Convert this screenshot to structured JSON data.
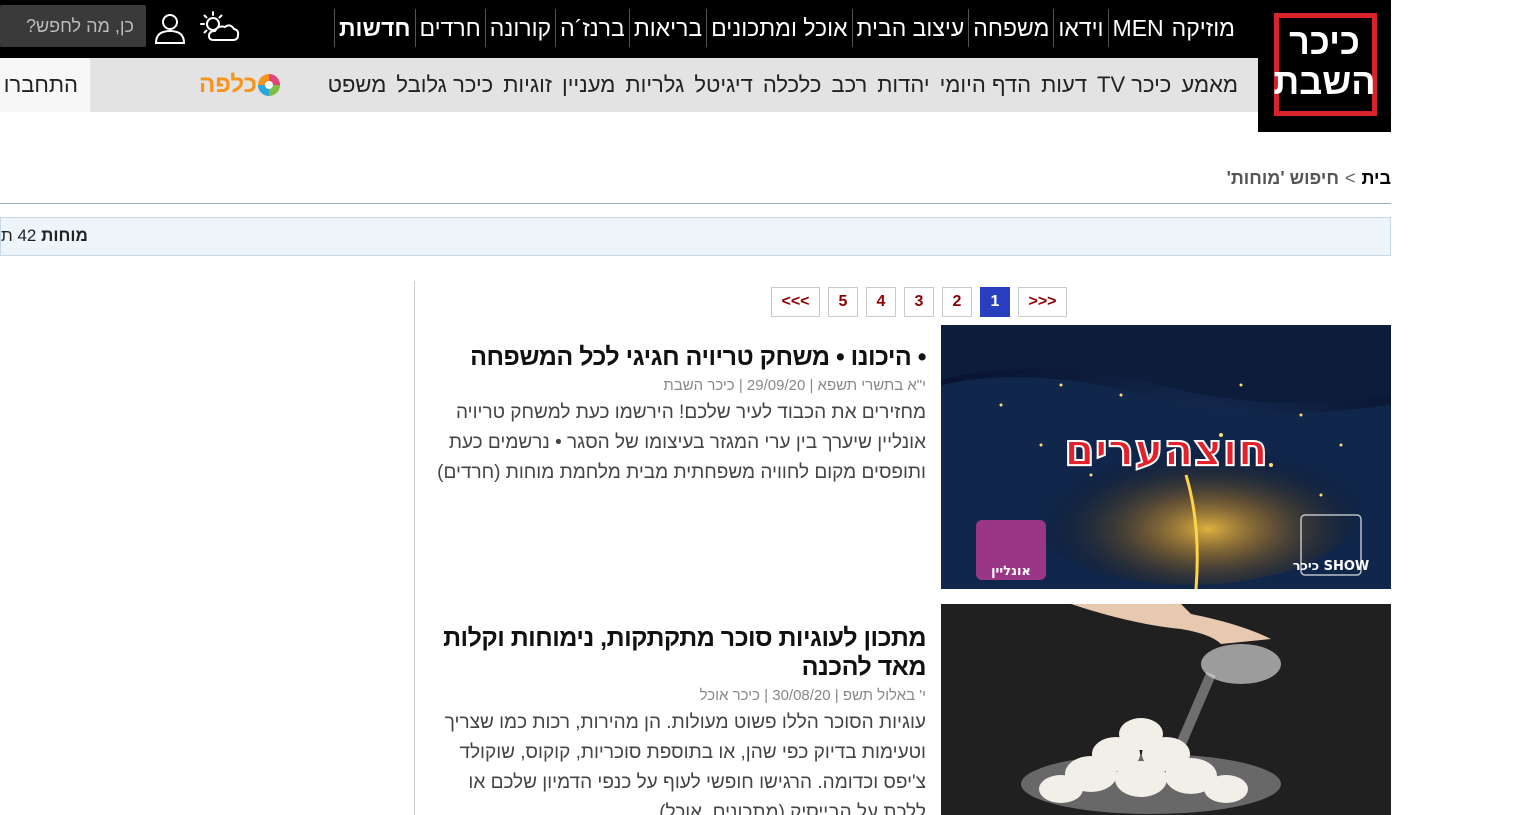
{
  "logo": {
    "line1": "כיכר",
    "line2": "השבת"
  },
  "main_nav": [
    {
      "label": "חדשות",
      "bold": true
    },
    {
      "label": "חרדים"
    },
    {
      "label": "קורונה"
    },
    {
      "label": "ברנז´ה"
    },
    {
      "label": "בריאות"
    },
    {
      "label": "אוכל ומתכונים"
    },
    {
      "label": "עיצוב הבית"
    },
    {
      "label": "משפחה"
    },
    {
      "label": "וידאו"
    },
    {
      "label": "MEN"
    },
    {
      "label": "מוזיקה"
    }
  ],
  "search": {
    "placeholder": "כן, מה לחפש?"
  },
  "icons": {
    "weather": "weather-partly-cloudy-icon",
    "user": "user-icon"
  },
  "sub_nav": [
    {
      "label": "משפט"
    },
    {
      "label": "כיכר גלובל"
    },
    {
      "label": "זוגיות"
    },
    {
      "label": "מעניין"
    },
    {
      "label": "גלריות"
    },
    {
      "label": "דיגיטל"
    },
    {
      "label": "כלכלה"
    },
    {
      "label": "רכב"
    },
    {
      "label": "יהדות"
    },
    {
      "label": "הדף היומי"
    },
    {
      "label": "דעות"
    },
    {
      "label": "כיכר TV"
    },
    {
      "label": "מאמע"
    }
  ],
  "kalpa": {
    "label": "כלפה"
  },
  "login": {
    "label": "התחברו"
  },
  "breadcrumb": {
    "home": "בית",
    "separator": ">",
    "current": "חיפוש 'מוחות'"
  },
  "results": {
    "term": "מוחות",
    "count_prefix": "42 ת"
  },
  "pagination": {
    "prev": ">>>",
    "pages": [
      "1",
      "2",
      "3",
      "4",
      "5"
    ],
    "active": "1",
    "next": "<<<"
  },
  "articles": [
    {
      "title": "• היכונו • משחק טריויה חגיגי לכל המשפחה",
      "meta": "י\"א בתשרי תשפא | 29/09/20 | כיכר השבת",
      "excerpt": "מחזירים את הכבוד לעיר שלכם! הירשמו כעת למשחק טריויה אונליין שיערך בין ערי המגזר בעיצומו של הסגר • נרשמים כעת ותופסים מקום לחוויה משפחתית מבית מלחמת מוחות (חרדים)",
      "image_text": "חוצהערים",
      "image_badge_left": "אונליין",
      "image_badge_right": "כיכר SHOW"
    },
    {
      "title": "מתכון לעוגיות סוכר מתקתקות, נימוחות וקלות מאד להכנה",
      "meta": "י' באלול תשפ | 30/08/20 | כיכר אוכל",
      "excerpt": "עוגיות הסוכר הללו פשוט מעולות. הן מהירות, רכות כמו שצריך וטעימות בדיוק כפי שהן, או בתוספת סוכריות, קוקוס, שוקולד צ'יפס וכדומה. הרגישו חופשי לעוף על כנפי הדמיון שלכם או ללכת על הבייסיק (מתכונים, אוכל)"
    }
  ],
  "colors": {
    "topbar": "#000000",
    "subbar": "#e3e3e3",
    "logo_red": "#d8232a",
    "page_active": "#2a3fbf",
    "page_text": "#8b0000",
    "kalpa_orange": "#f7941d"
  }
}
